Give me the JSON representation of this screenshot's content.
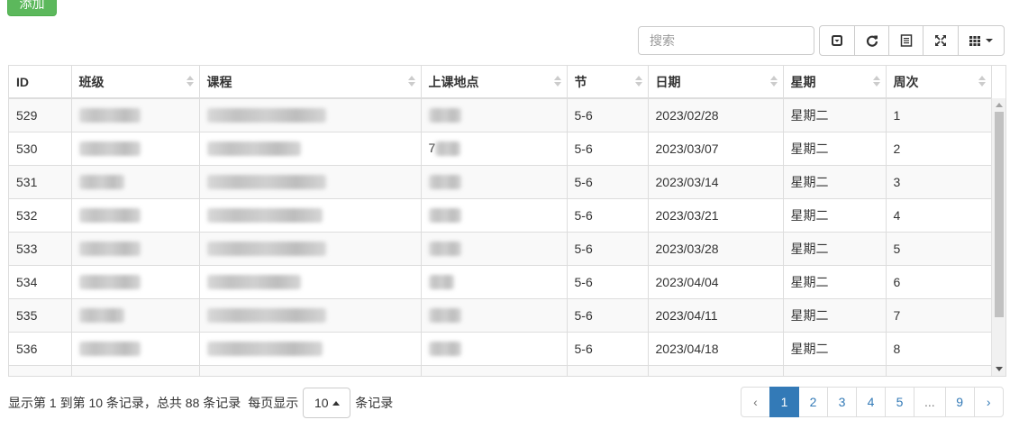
{
  "toolbar": {
    "add_label": "添加",
    "search_placeholder": "搜索",
    "buttons": [
      "toggle-pagination-icon",
      "refresh-icon",
      "toggle-view-icon",
      "fullscreen-icon",
      "columns-icon"
    ]
  },
  "table": {
    "headers": [
      "ID",
      "班级",
      "课程",
      "上课地点",
      "节",
      "日期",
      "星期",
      "周次"
    ],
    "rows": [
      {
        "id": "529",
        "section": "5-6",
        "date": "2023/02/28",
        "weekday": "星期二",
        "week": "1",
        "place": ""
      },
      {
        "id": "530",
        "section": "5-6",
        "date": "2023/03/07",
        "weekday": "星期二",
        "week": "2",
        "place": "7"
      },
      {
        "id": "531",
        "section": "5-6",
        "date": "2023/03/14",
        "weekday": "星期二",
        "week": "3",
        "place": ""
      },
      {
        "id": "532",
        "section": "5-6",
        "date": "2023/03/21",
        "weekday": "星期二",
        "week": "4",
        "place": ""
      },
      {
        "id": "533",
        "section": "5-6",
        "date": "2023/03/28",
        "weekday": "星期二",
        "week": "5",
        "place": ""
      },
      {
        "id": "534",
        "section": "5-6",
        "date": "2023/04/04",
        "weekday": "星期二",
        "week": "6",
        "place": ""
      },
      {
        "id": "535",
        "section": "5-6",
        "date": "2023/04/11",
        "weekday": "星期二",
        "week": "7",
        "place": ""
      },
      {
        "id": "536",
        "section": "5-6",
        "date": "2023/04/18",
        "weekday": "星期二",
        "week": "8",
        "place": ""
      }
    ]
  },
  "footer": {
    "summary": "显示第 1 到第 10 条记录，总共 88 条记录",
    "per_page_prefix": "每页显示",
    "page_size": "10",
    "per_page_suffix": "条记录"
  },
  "pagination": [
    "‹",
    "1",
    "2",
    "3",
    "4",
    "5",
    "...",
    "9",
    "›"
  ],
  "colors": {
    "add": "#5cb85c",
    "active_page": "#337ab7",
    "link": "#337ab7"
  }
}
